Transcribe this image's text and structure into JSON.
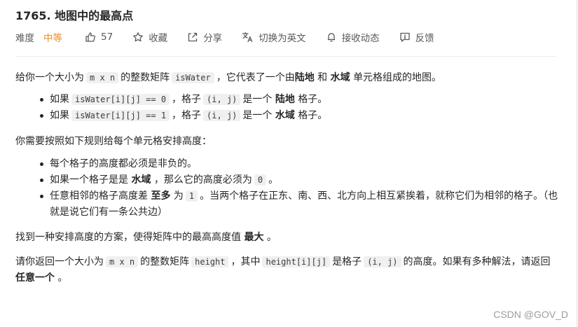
{
  "problem": {
    "title": "1765. 地图中的最高点"
  },
  "toolbar": {
    "difficulty_label": "难度",
    "difficulty_value": "中等",
    "likes": "57",
    "collect": "收藏",
    "share": "分享",
    "switch_lang": "切换为英文",
    "notify": "接收动态",
    "feedback": "反馈",
    "difficulty_color": "#ef8c22"
  },
  "description": {
    "p1": {
      "t1": "给你一个大小为",
      "c1": "m x n",
      "t2": "的整数矩阵",
      "c2": "isWater",
      "t3": "，它代表了一个由",
      "b1": "陆地",
      "t4": "和",
      "b2": "水域",
      "t5": "单元格组成的地图。"
    },
    "bullets1": [
      {
        "t1": "如果",
        "c1": "isWater[i][j] == 0",
        "t2": "，格子",
        "c2": "(i, j)",
        "t3": "是一个",
        "b1": "陆地",
        "t4": "格子。"
      },
      {
        "t1": "如果",
        "c1": "isWater[i][j] == 1",
        "t2": "，格子",
        "c2": "(i, j)",
        "t3": "是一个",
        "b1": "水域",
        "t4": "格子。"
      }
    ],
    "p2": "你需要按照如下规则给每个单元格安排高度：",
    "bullets2": {
      "b1": "每个格子的高度都必须是非负的。",
      "b2": {
        "t1": "如果一个格子是是",
        "b1": "水域",
        "t2": "，那么它的高度必须为",
        "c1": "0",
        "t3": "。"
      },
      "b3": {
        "t1": "任意相邻的格子高度差",
        "b1": "至多",
        "t2": "为",
        "c1": "1",
        "t3": "。当两个格子在正东、南、西、北方向上相互紧挨着，就称它们为相邻的格子。（也就是说它们有一条公共边）"
      }
    },
    "p3": {
      "t1": "找到一种安排高度的方案，使得矩阵中的最高高度值",
      "b1": "最大",
      "t2": "。"
    },
    "p4": {
      "t1": "请你返回一个大小为",
      "c1": "m x n",
      "t2": "的整数矩阵",
      "c2": "height",
      "t3": "，其中",
      "c3": "height[i][j]",
      "t4": "是格子",
      "c4": "(i, j)",
      "t5": "的高度。如果有多种解法，请返回",
      "b1": "任意一个",
      "t6": "。"
    }
  },
  "watermark": "CSDN @GOV_D",
  "icons": [
    "thumb-up-icon",
    "star-icon",
    "share-icon",
    "translate-icon",
    "bell-icon",
    "feedback-icon"
  ]
}
